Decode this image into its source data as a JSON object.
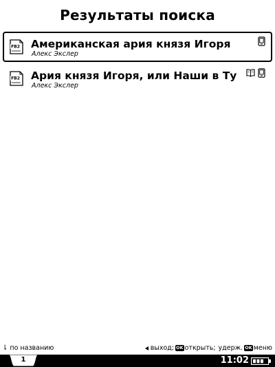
{
  "header": {
    "title": "Результаты поиска"
  },
  "results": [
    {
      "title": "Американская ария князя Игоря",
      "author": "Алекс Экслер",
      "format": "FB2",
      "selected": true,
      "status_icons": [
        "device-icon"
      ]
    },
    {
      "title": "Ария князя Игоря, или Наши в Тур...",
      "author": "Алекс Экслер",
      "format": "FB2",
      "selected": false,
      "status_icons": [
        "open-book-icon",
        "device-icon"
      ]
    }
  ],
  "footer": {
    "sort_label": "по названию",
    "exit_label": "выход;",
    "ok_key": "OK",
    "open_label": "открыть;",
    "hold_label": "удерж.",
    "menu_label": "меню"
  },
  "statusbar": {
    "page_tab": "1",
    "time": "11:02",
    "battery_icon": "battery-icon",
    "battery_level": 0.75
  }
}
